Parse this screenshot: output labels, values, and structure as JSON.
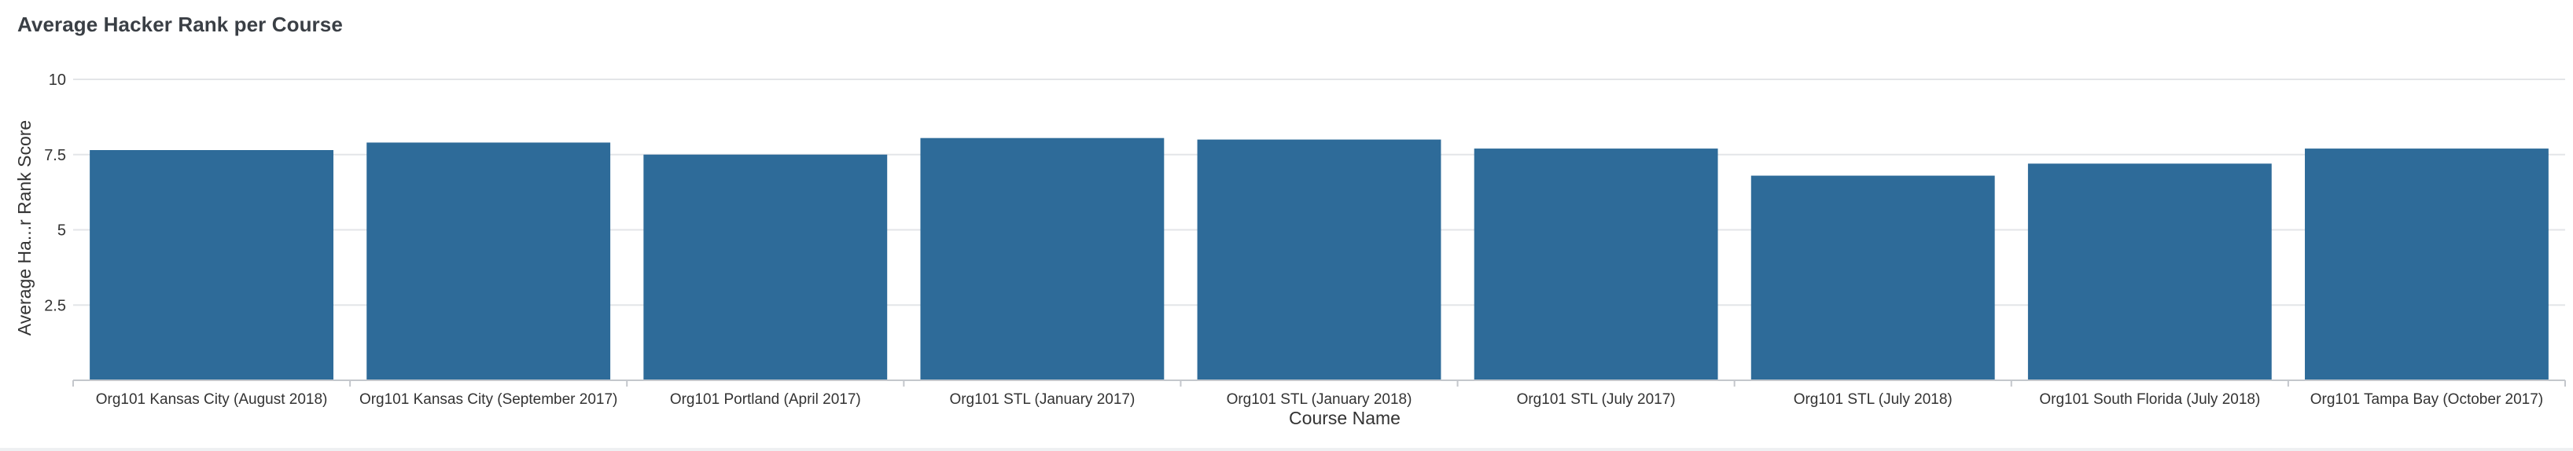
{
  "panel": {
    "title": "Average Hacker Rank per Course"
  },
  "chart_data": {
    "type": "bar",
    "title": "Average Hacker Rank per Course",
    "xlabel": "Course Name",
    "ylabel": "Average Ha...r Rank Score",
    "ylim": [
      0,
      10
    ],
    "yticks": [
      {
        "value": 2.5,
        "label": "2.5"
      },
      {
        "value": 5,
        "label": "5"
      },
      {
        "value": 7.5,
        "label": "7.5"
      },
      {
        "value": 10,
        "label": "10"
      }
    ],
    "grid": true,
    "bar_color": "#2e6b99",
    "categories": [
      "Org101 Kansas City (August 2018)",
      "Org101 Kansas City (September 2017)",
      "Org101 Portland (April 2017)",
      "Org101 STL (January 2017)",
      "Org101 STL (January 2018)",
      "Org101 STL (July 2017)",
      "Org101 STL (July 2018)",
      "Org101 South Florida (July 2018)",
      "Org101 Tampa Bay (October 2017)"
    ],
    "values": [
      7.65,
      7.9,
      7.5,
      8.05,
      8.0,
      7.7,
      6.8,
      7.2,
      7.7
    ]
  }
}
